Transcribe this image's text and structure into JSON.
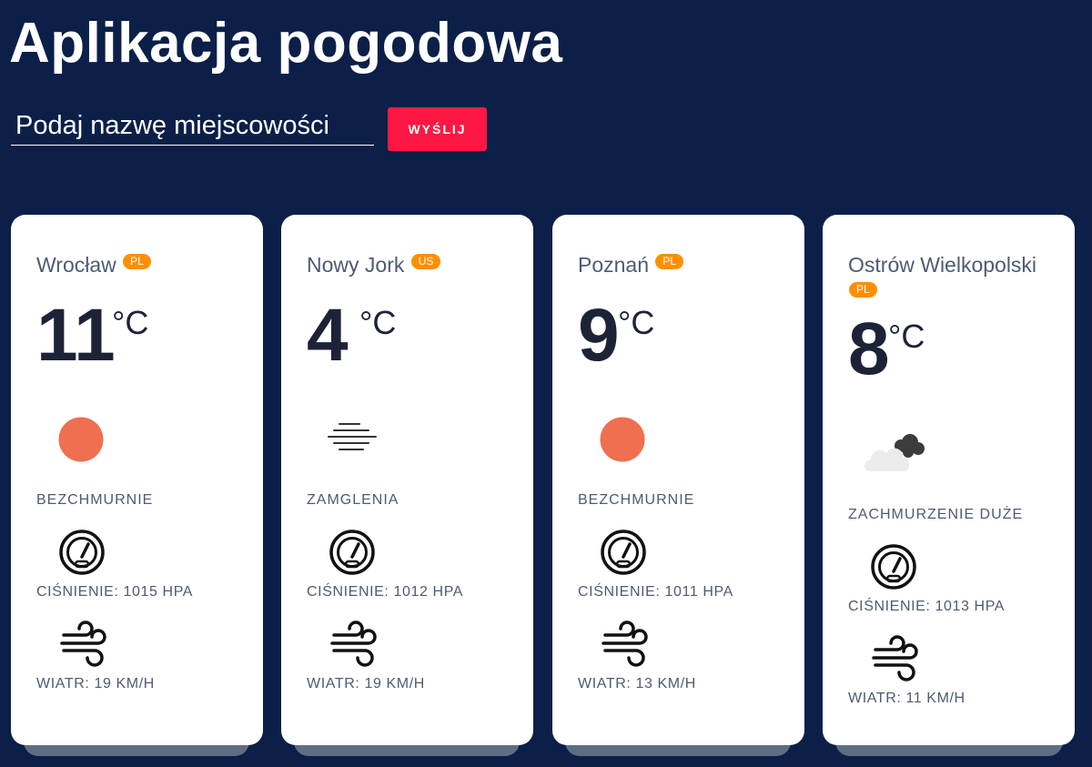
{
  "app": {
    "title": "Aplikacja pogodowa",
    "search_placeholder": "Podaj nazwę miejscowości",
    "send_label": "WYŚLIJ"
  },
  "cities": [
    {
      "name": "Wrocław",
      "country": "PL",
      "temperature": "11",
      "unit": "°C",
      "condition": "BEZCHMURNIE",
      "condition_icon": "sun-icon",
      "pressure": "CIŚNIENIE: 1015 HPA",
      "wind": "WIATR: 19 KM/H"
    },
    {
      "name": "Nowy Jork",
      "country": "US",
      "temperature": "4",
      "unit": "°C",
      "condition": "ZAMGLENIA",
      "condition_icon": "fog-icon",
      "pressure": "CIŚNIENIE: 1012 HPA",
      "wind": "WIATR: 19 KM/H"
    },
    {
      "name": "Poznań",
      "country": "PL",
      "temperature": "9",
      "unit": "°C",
      "condition": "BEZCHMURNIE",
      "condition_icon": "sun-icon",
      "pressure": "CIŚNIENIE: 1011 HPA",
      "wind": "WIATR: 13 KM/H"
    },
    {
      "name": "Ostrów Wielkopolski",
      "country": "PL",
      "temperature": "8",
      "unit": "°C",
      "condition": "ZACHMURZENIE DUŻE",
      "condition_icon": "cloud-icon",
      "pressure": "CIŚNIENIE: 1013 HPA",
      "wind": "WIATR: 11 KM/H"
    }
  ],
  "colors": {
    "background": "#0b1f48",
    "accent_button": "#ff1744",
    "badge": "#ff8f00",
    "sun": "#ef6f50"
  }
}
